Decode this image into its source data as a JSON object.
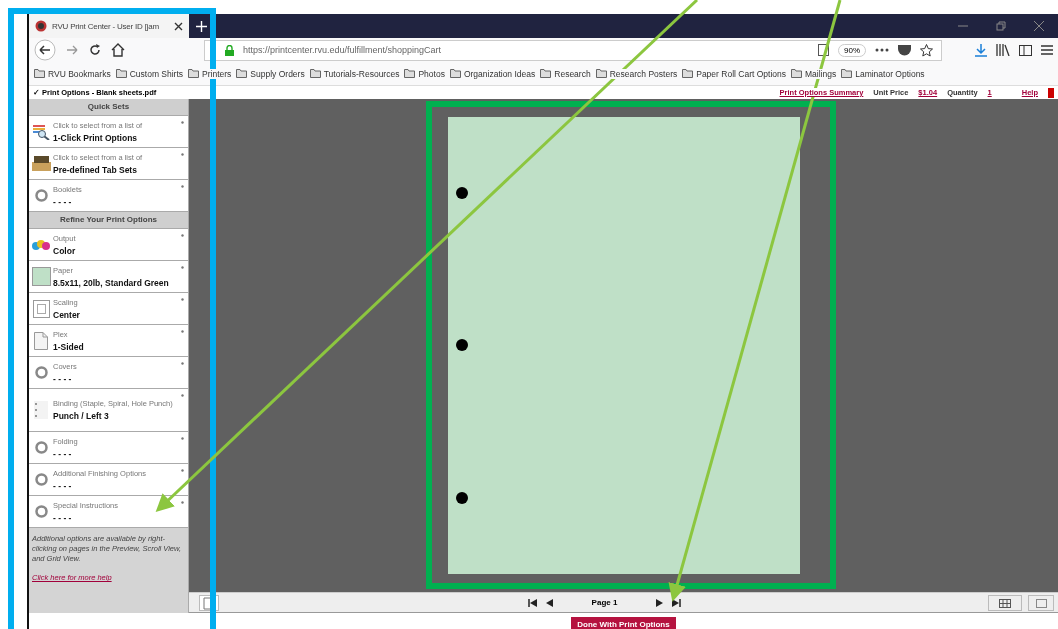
{
  "browser": {
    "tab_title": "RVU Print Center - User ID [jam",
    "url": "https://printcenter.rvu.edu/fulfillment/shoppingCart",
    "zoom": "90%"
  },
  "bookmarks": [
    "RVU Bookmarks",
    "Custom Shirts",
    "Printers",
    "Supply Orders",
    "Tutorials-Resources",
    "Photos",
    "Organization Ideas",
    "Research",
    "Research Posters",
    "Paper Roll Cart Options",
    "Mailings",
    "Laminator Options"
  ],
  "info_bar": {
    "document": "✓ Print Options - Blank sheets.pdf",
    "summary_link": "Print Options Summary",
    "unit_price_label": "Unit Price",
    "unit_price": "$1.04",
    "quantity_label": "Quantity",
    "quantity": "1",
    "help": "Help"
  },
  "sidebar": {
    "sections": [
      {
        "header": "Quick Sets",
        "items": [
          {
            "kind": "list",
            "label": "Click to select from a list of",
            "value": "1-Click Print Options"
          },
          {
            "kind": "tray",
            "label": "Click to select from a list of",
            "value": "Pre-defined Tab Sets"
          },
          {
            "kind": "ring",
            "label": "Booklets",
            "value": "- - - -"
          }
        ]
      },
      {
        "header": "Refine Your Print Options",
        "items": [
          {
            "kind": "drops",
            "label": "Output",
            "value": "Color"
          },
          {
            "kind": "swatch",
            "label": "Paper",
            "value": "8.5x11, 20lb, Standard Green"
          },
          {
            "kind": "frame",
            "label": "Scaling",
            "value": "Center"
          },
          {
            "kind": "sheet",
            "label": "Plex",
            "value": "1-Sided"
          },
          {
            "kind": "ring",
            "label": "Covers",
            "value": "- - - -"
          },
          {
            "kind": "holes",
            "label": "Binding (Staple, Spiral, Hole Punch)",
            "value": "Punch / Left 3"
          },
          {
            "kind": "ring",
            "label": "Folding",
            "value": "- - - -"
          },
          {
            "kind": "ring",
            "label": "Additional Finishing Options",
            "value": "- - - -"
          },
          {
            "kind": "ring",
            "label": "Special Instructions",
            "value": "- - - -"
          }
        ]
      }
    ],
    "note": "Additional options are available by right-clicking on pages in the Preview, Scroll View, and Grid View.",
    "help_link": "Click here for more help"
  },
  "pager": {
    "page": "Page 1"
  },
  "done_button": "Done With Print Options"
}
